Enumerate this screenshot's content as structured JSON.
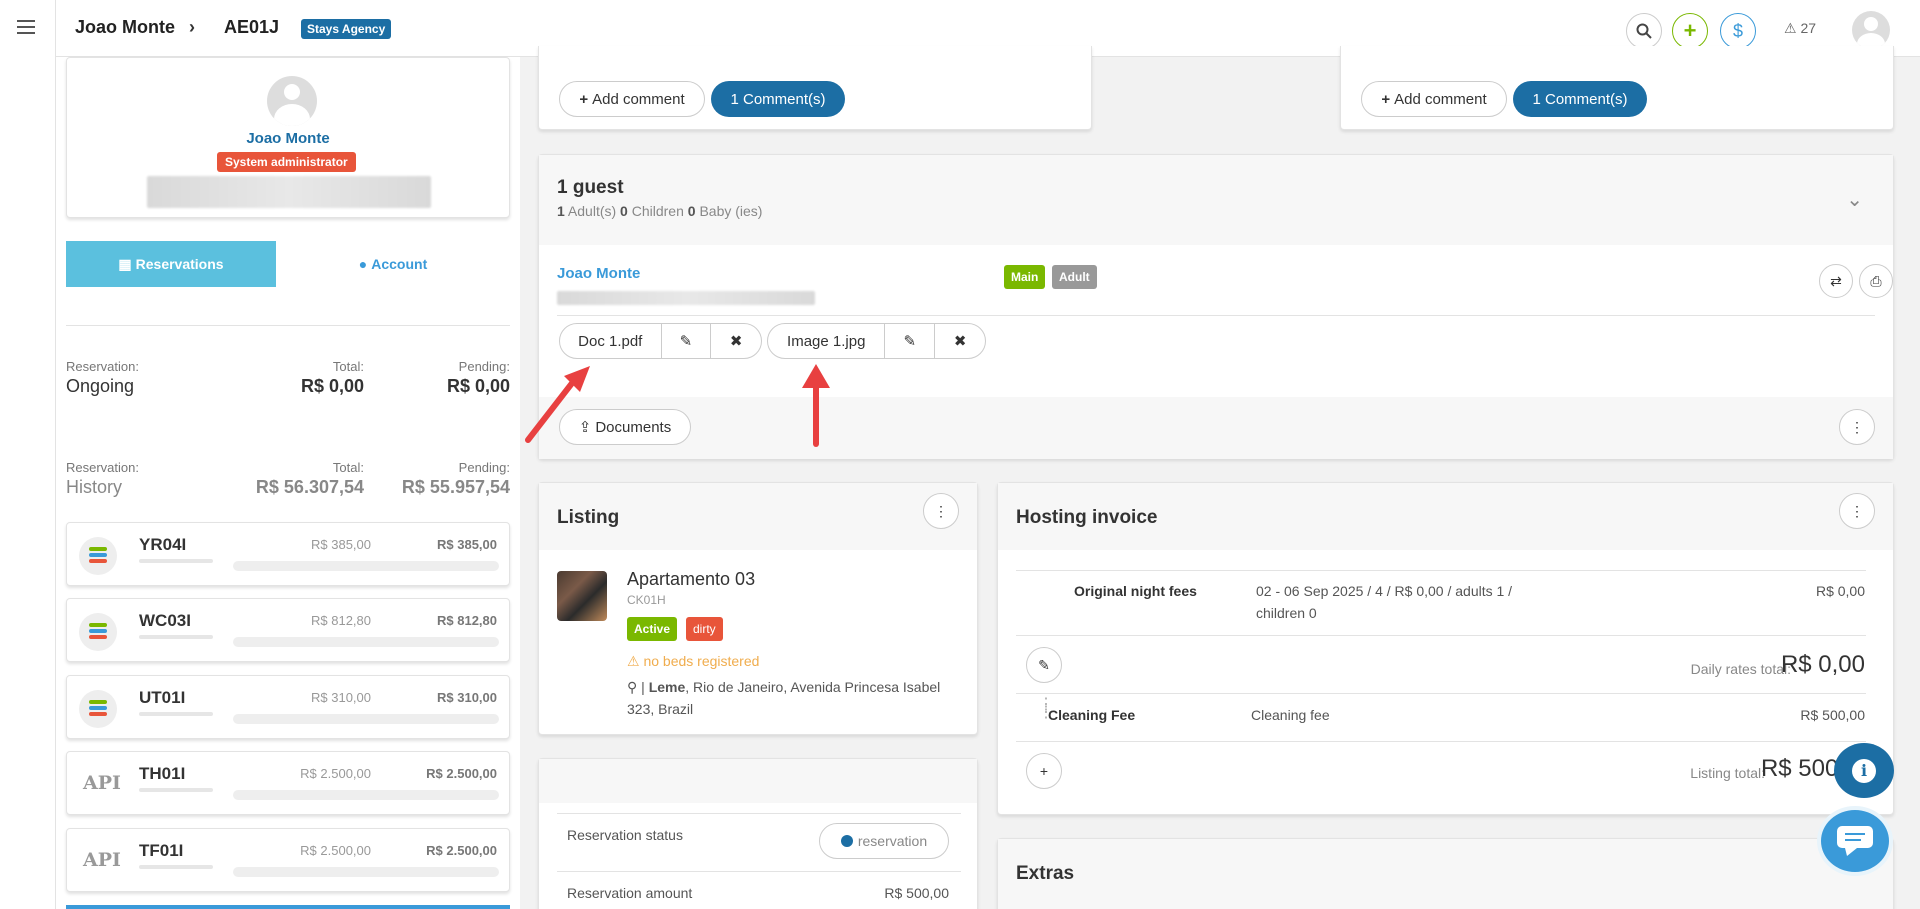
{
  "topbar": {
    "user": "Joao Monte",
    "reservation_code": "AE01J",
    "agency_badge": "Stays Agency",
    "alerts_count": "27"
  },
  "profile": {
    "name": "Joao Monte",
    "role": "System administrator"
  },
  "left_tabs": {
    "reservations": "Reservations",
    "account": "Account"
  },
  "summary": {
    "ongoing": {
      "label": "Reservation:",
      "status": "Ongoing",
      "total_label": "Total:",
      "total": "R$ 0,00",
      "pending_label": "Pending:",
      "pending": "R$ 0,00"
    },
    "history": {
      "label": "Reservation:",
      "status": "History",
      "total_label": "Total:",
      "total": "R$ 56.307,54",
      "pending_label": "Pending:",
      "pending": "R$ 55.957,54"
    }
  },
  "reservations": [
    {
      "code": "YR04I",
      "icon": "stack-icon",
      "total": "R$ 385,00",
      "pending": "R$ 385,00"
    },
    {
      "code": "WC03I",
      "icon": "stack-icon",
      "total": "R$ 812,80",
      "pending": "R$ 812,80"
    },
    {
      "code": "UT01I",
      "icon": "stack-icon",
      "total": "R$ 310,00",
      "pending": "R$ 310,00"
    },
    {
      "code": "TH01I",
      "icon": "api-icon",
      "icon_text": "API",
      "total": "R$ 2.500,00",
      "pending": "R$ 2.500,00"
    },
    {
      "code": "TF01I",
      "icon": "api-icon",
      "icon_text": "API",
      "total": "R$ 2.500,00",
      "pending": "R$ 2.500,00"
    }
  ],
  "comments": {
    "add_label": "Add comment",
    "count_label": "1 Comment(s)"
  },
  "guests": {
    "title": "1 guest",
    "adults": "1",
    "adults_label": "Adult(s)",
    "children": "0",
    "children_label": "Children",
    "babies": "0",
    "babies_label": "Baby (ies)",
    "guest_name": "Joao Monte",
    "tag_main": "Main",
    "tag_adult": "Adult",
    "files": [
      "Doc 1.pdf",
      "Image 1.jpg"
    ],
    "documents_label": "Documents"
  },
  "listing": {
    "title": "Listing",
    "name": "Apartamento 03",
    "code": "CK01H",
    "status_active": "Active",
    "status_dirty": "dirty",
    "warning": "no beds registered",
    "address_bold": "Leme",
    "address": ", Rio de Janeiro, Avenida Princesa Isabel 323, Brazil"
  },
  "reservation_info": {
    "status_label": "Reservation status",
    "status_value": "reservation",
    "amount_label": "Reservation amount",
    "amount_value": "R$ 500,00"
  },
  "invoice": {
    "title": "Hosting invoice",
    "night_fees_label": "Original night fees",
    "night_fees_detail": "02 - 06 Sep 2025  /  4 /  R$ 0,00  /  adults 1 /",
    "night_fees_detail2": "children 0",
    "night_fees_amount": "R$ 0,00",
    "daily_total_label": "Daily rates total:",
    "daily_total": "R$ 0,00",
    "cleaning_label": "Cleaning Fee",
    "cleaning_desc": "Cleaning fee",
    "cleaning_amount": "R$ 500,00",
    "listing_total_label": "Listing total:",
    "listing_total": "R$ 500,"
  },
  "extras": {
    "title": "Extras"
  },
  "colors": {
    "brand": "#1c6ea4",
    "accent_light": "#5bc0de",
    "success": "#7ab800",
    "danger": "#e8553a",
    "warning": "#f0ad4e"
  }
}
